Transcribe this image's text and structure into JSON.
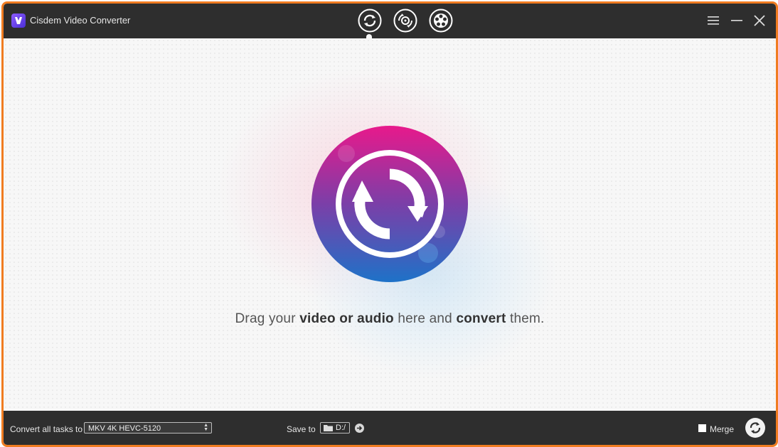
{
  "app": {
    "title": "Cisdem Video Converter",
    "logo_icon": "app-logo-icon"
  },
  "modes": [
    {
      "name": "convert",
      "icon": "convert-icon",
      "active": true
    },
    {
      "name": "rip-dvd",
      "icon": "disc-rip-icon",
      "active": false
    },
    {
      "name": "download",
      "icon": "film-reel-icon",
      "active": false
    }
  ],
  "window_controls": [
    "menu-icon",
    "minimize-icon",
    "close-icon"
  ],
  "dropzone": {
    "icon": "convert-circle-icon",
    "text_prefix": "Drag your ",
    "text_bold1": "video or audio",
    "text_middle": " here and ",
    "text_bold2": "convert",
    "text_suffix": " them."
  },
  "bottom": {
    "convert_label": "Convert all tasks to",
    "format_value": "MKV 4K HEVC-5120",
    "save_label": "Save to",
    "save_path": "D:/",
    "merge_label": "Merge",
    "merge_checked": false
  },
  "colors": {
    "accent_border": "#f07c21",
    "bar_bg": "#2e2e2e",
    "gradient_top": "#e8198b",
    "gradient_mid": "#7b3fa8",
    "gradient_bottom": "#1e72c8"
  }
}
